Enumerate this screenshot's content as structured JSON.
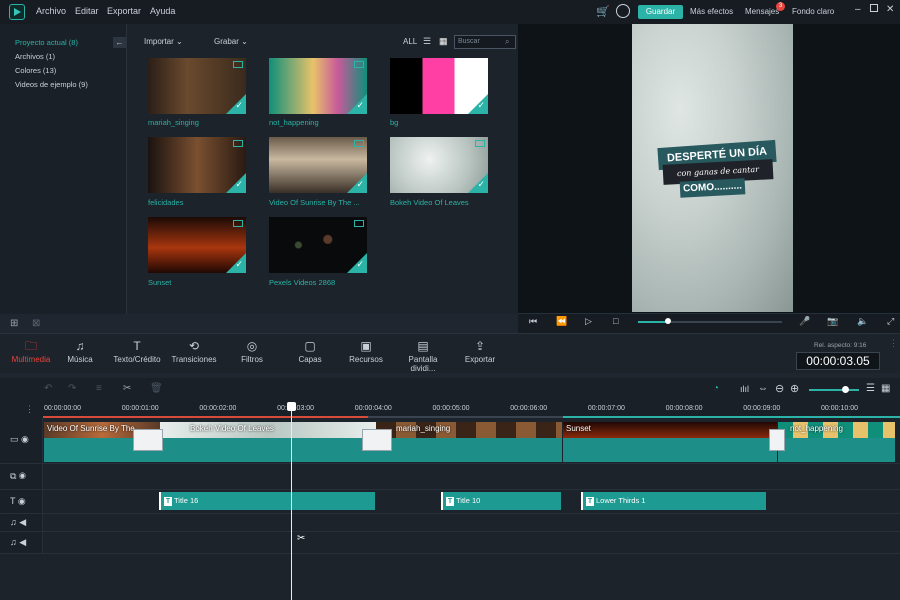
{
  "menu": {
    "items": [
      "Archivo",
      "Editar",
      "Exportar",
      "Ayuda"
    ]
  },
  "topbar": {
    "save_label": "Guardar",
    "effects_label": "Más efectos",
    "messages_label": "Mensajes",
    "messages_badge": "3",
    "theme_label": "Fondo claro"
  },
  "library": {
    "sidebar": [
      "Proyecto actual (8)",
      "Archivos (1)",
      "Colores (13)",
      "Videos de ejemplo (9)"
    ],
    "import_label": "Importar",
    "record_label": "Grabar",
    "all_label": "ALL",
    "search_placeholder": "Buscar",
    "items": [
      {
        "label": "mariah_singing"
      },
      {
        "label": "not_happening"
      },
      {
        "label": "bg"
      },
      {
        "label": "felicidades"
      },
      {
        "label": "Video Of Sunrise By The ..."
      },
      {
        "label": "Bokeh Video Of Leaves"
      },
      {
        "label": "Sunset"
      },
      {
        "label": "Pexels Videos 2868"
      }
    ]
  },
  "preview": {
    "title_text": "DESPERTÉ UN DÍA",
    "subtitle_text": "con ganas de cantar",
    "line3_text": "COMO..........",
    "playback_progress": 0.2
  },
  "toolbar": {
    "tools": [
      {
        "label": "Multimedia",
        "icon": "folder-icon",
        "active": true
      },
      {
        "label": "Música",
        "icon": "music-note-icon"
      },
      {
        "label": "Texto/Crédito",
        "icon": "text-icon"
      },
      {
        "label": "Transiciones",
        "icon": "transition-icon"
      },
      {
        "label": "Filtros",
        "icon": "filter-icon"
      },
      {
        "label": "Capas",
        "icon": "overlay-icon"
      },
      {
        "label": "Recursos",
        "icon": "image-icon"
      },
      {
        "label": "Pantalla dividi...",
        "icon": "split-screen-icon"
      },
      {
        "label": "Exportar",
        "icon": "export-icon"
      }
    ],
    "aspect_label": "Rel. aspecto: 9:16",
    "timecode": "00:00:03.05"
  },
  "timeline": {
    "ruler": [
      "00:00:00:00",
      "00:00:01:00",
      "00:00:02:00",
      "00:00:03:00",
      "00:00:04:00",
      "00:00:05:00",
      "00:00:06:00",
      "00:00:07:00",
      "00:00:08:00",
      "00:00:09:00",
      "00:00:10:00"
    ],
    "video_clips": [
      "Video Of Sunrise By The",
      "Bokeh Video Of Leaves",
      "mariah_singing",
      "Sunset",
      "not_happening"
    ],
    "title_clips": [
      "Title 16",
      "Title 10",
      "Lower Thirds 1"
    ]
  },
  "colors": {
    "accent": "#2ab3a6",
    "active_tool": "#e8453c",
    "background": "#1f2630"
  }
}
